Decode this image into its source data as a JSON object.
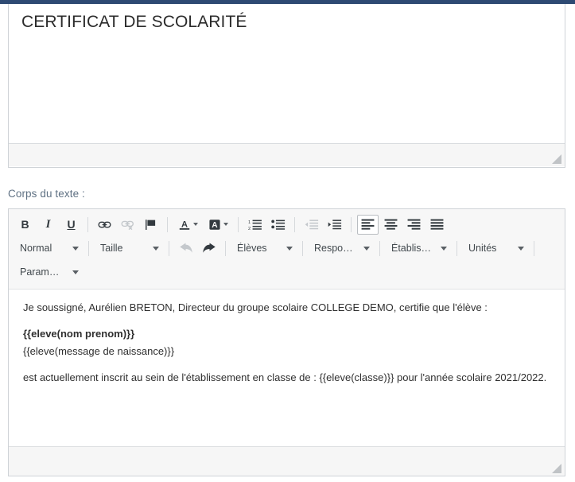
{
  "app": {
    "accent_color": "#2e4a73",
    "toolbar_bg": "#f7f7f7",
    "label_color": "#5f7183"
  },
  "title_field": {
    "name": "document-title",
    "value": "CERTIFICAT DE SCOLARITÉ",
    "placeholder": ""
  },
  "body_label": "Corps du texte :",
  "toolbar": {
    "row1": [
      {
        "name": "bold-icon",
        "label": "B",
        "kind": "text",
        "style": "bold",
        "state": "enabled"
      },
      {
        "name": "italic-icon",
        "label": "I",
        "kind": "text",
        "style": "italic",
        "state": "enabled"
      },
      {
        "name": "underline-icon",
        "label": "U",
        "kind": "text",
        "style": "underline",
        "state": "enabled"
      },
      {
        "name": "link-icon",
        "label": "",
        "kind": "icon",
        "state": "enabled"
      },
      {
        "name": "unlink-icon",
        "label": "",
        "kind": "icon",
        "state": "disabled"
      },
      {
        "name": "flag-icon",
        "label": "",
        "kind": "icon",
        "state": "enabled"
      },
      {
        "name": "font-color-icon",
        "label": "A",
        "kind": "icon",
        "state": "enabled"
      },
      {
        "name": "background-color-icon",
        "label": "A",
        "kind": "icon",
        "state": "enabled"
      },
      {
        "name": "ordered-list-icon",
        "label": "",
        "kind": "icon",
        "state": "enabled"
      },
      {
        "name": "unordered-list-icon",
        "label": "",
        "kind": "icon",
        "state": "enabled"
      },
      {
        "name": "outdent-icon",
        "label": "",
        "kind": "icon",
        "state": "disabled"
      },
      {
        "name": "indent-icon",
        "label": "",
        "kind": "icon",
        "state": "enabled"
      },
      {
        "name": "align-left-icon",
        "label": "",
        "kind": "icon",
        "state": "selected"
      },
      {
        "name": "align-center-icon",
        "label": "",
        "kind": "icon",
        "state": "enabled"
      },
      {
        "name": "align-right-icon",
        "label": "",
        "kind": "icon",
        "state": "enabled"
      },
      {
        "name": "align-justify-icon",
        "label": "",
        "kind": "icon",
        "state": "enabled"
      }
    ],
    "style_select": "Normal",
    "size_select": "Taille",
    "undo_label": "undo-icon",
    "redo_label": "redo-icon",
    "merge_selects": [
      {
        "name": "eleves",
        "label": "Élèves"
      },
      {
        "name": "responsables",
        "label": "Respons…"
      },
      {
        "name": "etablissement",
        "label": "Établiss…"
      },
      {
        "name": "unites",
        "label": "Unités"
      },
      {
        "name": "parametres",
        "label": "Paramèt…"
      }
    ]
  },
  "body_content": {
    "lines": [
      {
        "text": "Je soussigné, Aurélien BRETON, Directeur du groupe scolaire COLLEGE DEMO, certifie que l'élève :",
        "bold": false,
        "tight": false
      },
      {
        "text": "{{eleve(nom prenom)}}",
        "bold": true,
        "tight": true
      },
      {
        "text": "{{eleve(message de naissance)}}",
        "bold": false,
        "tight": false
      },
      {
        "text": "est actuellement inscrit au sein de l'établissement en classe de : {{eleve(classe)}} pour l'année scolaire 2021/2022.",
        "bold": false,
        "tight": false
      }
    ]
  }
}
